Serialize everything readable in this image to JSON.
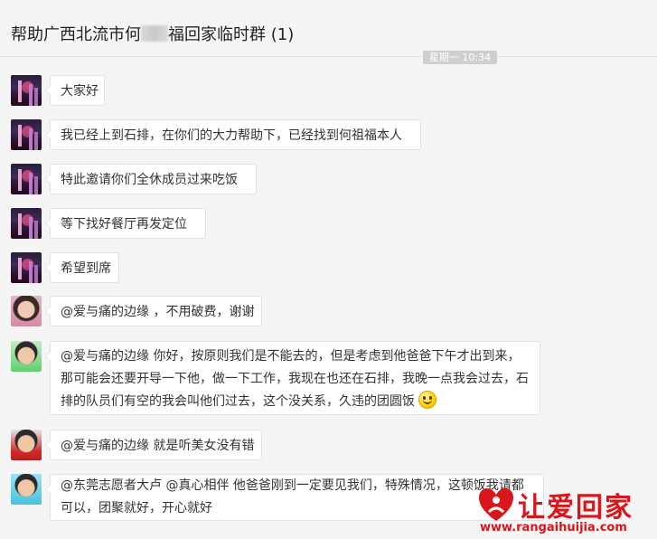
{
  "chat": {
    "title_before": "帮助广西北流市何",
    "title_after": "福回家临时群 (1)",
    "timestamp": "星期一 10:34"
  },
  "messages": [
    {
      "avatar": "city-night",
      "text": "大家好"
    },
    {
      "avatar": "city-night",
      "text": "我已经上到石排，在你们的大力帮助下，已经找到何祖福本人"
    },
    {
      "avatar": "city-night",
      "text": "特此邀请你们全休成员过来吃饭"
    },
    {
      "avatar": "city-night",
      "text": "等下找好餐厅再发定位"
    },
    {
      "avatar": "city-night",
      "text": "希望到席"
    },
    {
      "avatar": "girl",
      "text": "@爱与痛的边缘 ，不用破费，谢谢"
    },
    {
      "avatar": "boy-green",
      "text": "@爱与痛的边缘 你好，按原则我们是不能去的，但是考虑到他爸爸下午才出到来，那可能会还要开导一下他，做一下工作，我现在也还在石排，我晚一点我会过去，石排的队员们有空的我会叫他们过去，这个没关系，久违的团圆饭",
      "emoji": "smiley-icon"
    },
    {
      "avatar": "boy-red",
      "text": "@爱与痛的边缘 就是听美女没有错"
    },
    {
      "avatar": "boy-blue",
      "text": "@东莞志愿者大卢 @真心相伴 他爸爸刚到一定要见我们，特殊情况，这顿饭我请都可以，团聚就好，开心就好"
    }
  ],
  "watermark": {
    "brand": "让爱回家",
    "url": "www.rangaihuijia.com",
    "color": "#d8161b"
  }
}
